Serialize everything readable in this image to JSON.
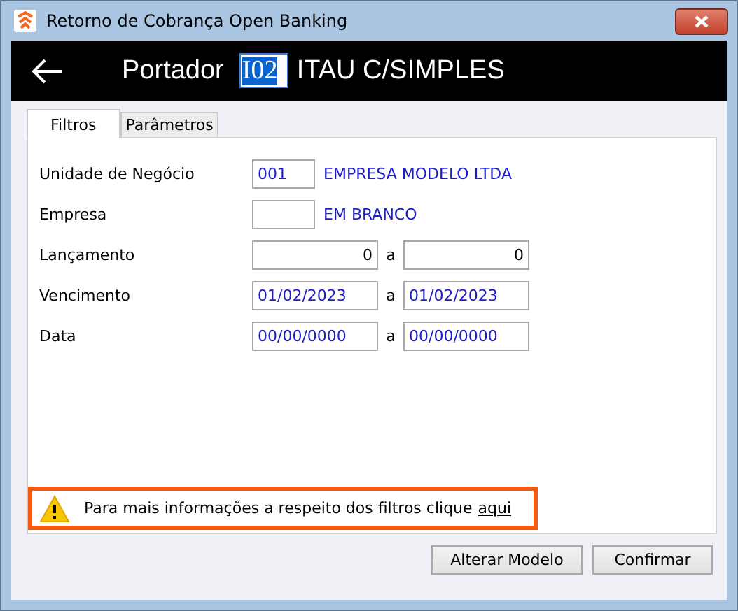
{
  "window": {
    "title": "Retorno de Cobrança Open Banking"
  },
  "header": {
    "label": "Portador",
    "code": {
      "value": "I02",
      "selected": true
    },
    "name": "ITAU C/SIMPLES"
  },
  "tabs": [
    {
      "label": "Filtros",
      "selected": true
    },
    {
      "label": "Parâmetros",
      "selected": false
    }
  ],
  "rows": [
    {
      "kind": "code",
      "label": "Unidade de Negócio",
      "value": "001",
      "description": "EMPRESA MODELO LTDA"
    },
    {
      "kind": "code",
      "label": "Empresa",
      "description": "EM BRANCO"
    },
    {
      "kind": "number",
      "label": "Lançamento",
      "from": "0",
      "separator": "a",
      "to": "0"
    },
    {
      "kind": "date",
      "label": "Vencimento",
      "from": "01/02/2023",
      "separator": "a",
      "to": "01/02/2023"
    },
    {
      "kind": "date",
      "label": "Data",
      "from": "00/00/0000",
      "separator": "a",
      "to": "00/00/0000"
    }
  ],
  "notice": {
    "text": "Para mais informações a respeito dos filtros clique",
    "link": "aqui"
  },
  "buttons": [
    "Alterar Modelo",
    "Confirmar"
  ]
}
